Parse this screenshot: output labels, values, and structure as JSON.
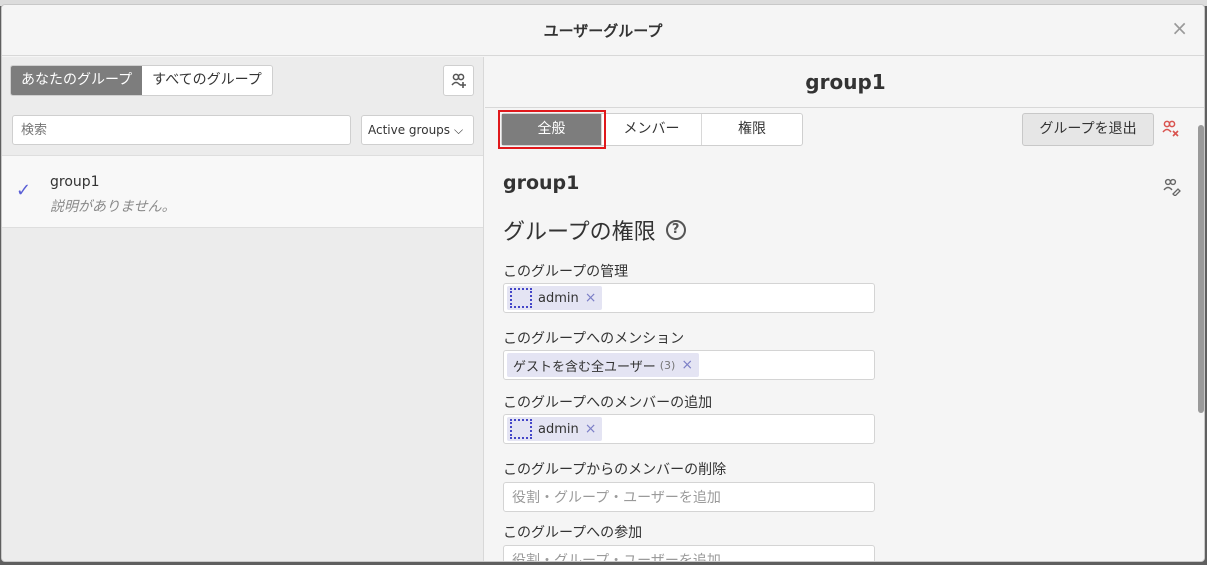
{
  "modal": {
    "title": "ユーザーグループ",
    "close": "×"
  },
  "left": {
    "segments": [
      "あなたのグループ",
      "すべてのグループ"
    ],
    "search_placeholder": "検索",
    "filter": {
      "selected": "Active groups",
      "chevron": "⌵"
    },
    "groups": [
      {
        "name": "group1",
        "description": "説明がありません。",
        "check": "✓"
      }
    ]
  },
  "right": {
    "title": "group1",
    "tabs": [
      "全般",
      "メンバー",
      "権限"
    ],
    "leave_label": "グループを退出",
    "group_name": "group1",
    "section_title": "グループの権限",
    "help": "?",
    "permissions": [
      {
        "label": "このグループの管理",
        "chips": [
          {
            "icon": "role-icon",
            "text": "admin",
            "remove": "×"
          }
        ],
        "placeholder": ""
      },
      {
        "label": "このグループへのメンション",
        "chips": [
          {
            "icon": "",
            "text": "ゲストを含む全ユーザー",
            "count": "(3)",
            "remove": "×"
          }
        ],
        "placeholder": ""
      },
      {
        "label": "このグループへのメンバーの追加",
        "chips": [
          {
            "icon": "role-icon",
            "text": "admin",
            "remove": "×"
          }
        ],
        "placeholder": ""
      },
      {
        "label": "このグループからのメンバーの削除",
        "chips": [],
        "placeholder": "役割・グループ・ユーザーを追加"
      },
      {
        "label": "このグループへの参加",
        "chips": [],
        "placeholder": "役割・グループ・ユーザーを追加"
      }
    ]
  },
  "colors": {
    "accent": "#5a5fd6",
    "highlight_outline": "#e0191c",
    "chip_bg": "#e4e4f3",
    "danger_icon": "#d9534f"
  }
}
